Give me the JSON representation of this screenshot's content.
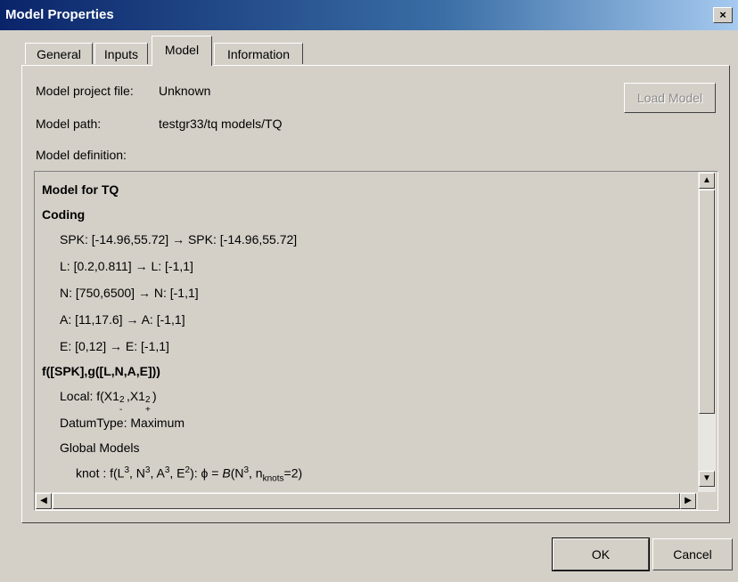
{
  "window": {
    "title": "Model Properties",
    "close_glyph": "×"
  },
  "tabs": [
    {
      "label": "General"
    },
    {
      "label": "Inputs"
    },
    {
      "label": "Model"
    },
    {
      "label": "Information"
    }
  ],
  "fields": {
    "project_label": "Model project file:",
    "project_value": "Unknown",
    "path_label": "Model path:",
    "path_value": "testgr33/tq models/TQ",
    "definition_label": "Model definition:"
  },
  "load_button": "Load Model",
  "definition": {
    "title": "Model for TQ",
    "coding_header": "Coding",
    "coding": [
      "SPK: [-14.96,55.72] → SPK: [-14.96,55.72]",
      "L: [0.2,0.811] → L: [-1,1]",
      "N: [750,6500] → N: [-1,1]",
      "A: [11,17.6] → A: [-1,1]",
      "E: [0,12] → E: [-1,1]"
    ],
    "function_header": "f([SPK],g([L,N,A,E]))",
    "local_prefix": "Local: f(X1",
    "datum_type": "DatumType: Maximum",
    "global_models": "Global Models",
    "knot_prefix": "knot   : f(L",
    "knot_n": ", N",
    "knot_a": ", A",
    "knot_e": ", E",
    "knot_mid": "): ϕ = ",
    "knot_B": "B",
    "knot_paren": "(N",
    "knot_n2": ", n",
    "knot_sub": "knots",
    "knot_end": "=2)"
  },
  "buttons": {
    "ok": "OK",
    "cancel": "Cancel"
  },
  "icons": {
    "scroll_up": "▲",
    "scroll_down": "▼",
    "scroll_left": "◀",
    "scroll_right": "▶"
  }
}
